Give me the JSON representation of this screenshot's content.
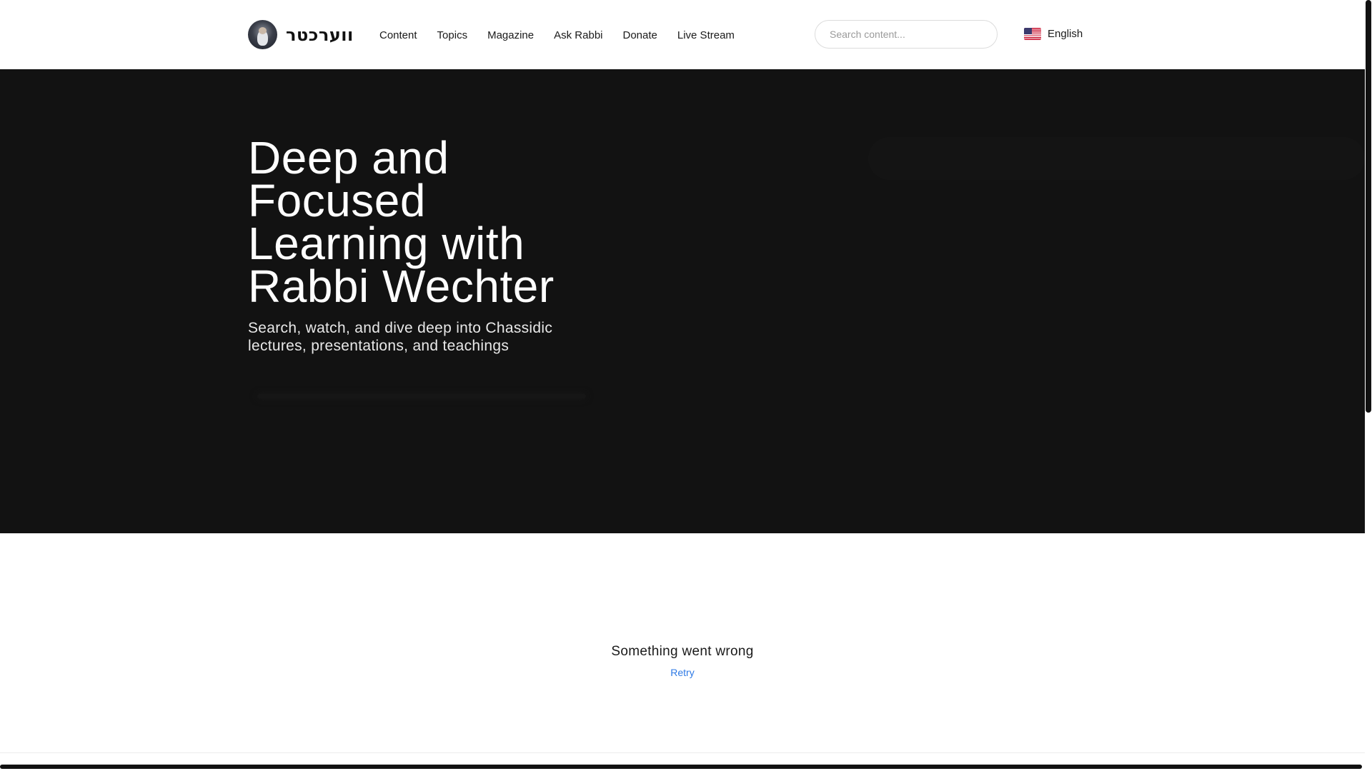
{
  "brand": {
    "logo_text": "ווערכטר",
    "avatar_alt": "avatar"
  },
  "nav": {
    "items": [
      {
        "label": "Content"
      },
      {
        "label": "Topics"
      },
      {
        "label": "Magazine"
      },
      {
        "label": "Ask Rabbi"
      },
      {
        "label": "Donate"
      },
      {
        "label": "Live Stream"
      }
    ]
  },
  "search": {
    "placeholder": "Search content...",
    "value": ""
  },
  "language": {
    "label": "English",
    "flag_icon": "us-flag-icon"
  },
  "hero": {
    "title": "Deep and Focused Learning with Rabbi Wechter",
    "subtitle": "Search, watch, and dive deep into Chassidic lectures, presentations, and teachings"
  },
  "error": {
    "message": "Something went wrong",
    "retry_label": "Retry"
  },
  "colors": {
    "hero_bg": "#121212",
    "link": "#2f7ae5",
    "text": "#1a1a1a"
  }
}
